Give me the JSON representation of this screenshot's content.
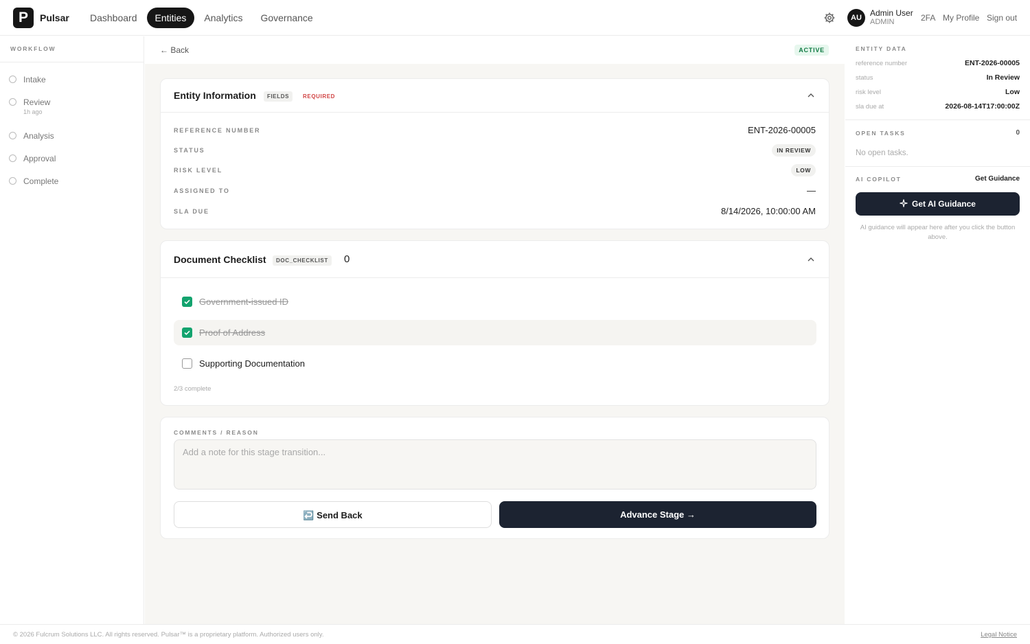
{
  "app": {
    "logo_letter": "P",
    "name": "Pulsar"
  },
  "nav": {
    "items": [
      {
        "label": "Dashboard",
        "active": false
      },
      {
        "label": "Entities",
        "active": true
      },
      {
        "label": "Analytics",
        "active": false
      },
      {
        "label": "Governance",
        "active": false
      }
    ]
  },
  "user": {
    "initials": "AU",
    "name": "Admin User",
    "role": "ADMIN",
    "links": [
      "2FA",
      "My Profile",
      "Sign out"
    ]
  },
  "workflow": {
    "title": "WORKFLOW",
    "steps": [
      {
        "label": "Intake",
        "sub": ""
      },
      {
        "label": "Review",
        "sub": "1h ago"
      },
      {
        "label": "Analysis",
        "sub": ""
      },
      {
        "label": "Approval",
        "sub": ""
      },
      {
        "label": "Complete",
        "sub": ""
      }
    ]
  },
  "main": {
    "back_label": "← Back",
    "status_badge": "ACTIVE",
    "entity_info": {
      "title": "Entity Information",
      "tag_fields": "FIELDS",
      "tag_required": "REQUIRED",
      "fields": [
        {
          "label": "REFERENCE NUMBER",
          "value": "ENT-2026-00005"
        },
        {
          "label": "STATUS",
          "value": "IN REVIEW"
        },
        {
          "label": "RISK LEVEL",
          "value": "LOW"
        },
        {
          "label": "ASSIGNED TO",
          "value": "—"
        },
        {
          "label": "SLA DUE",
          "value": "8/14/2026, 10:00:00 AM"
        }
      ]
    },
    "checklist": {
      "title": "Document Checklist",
      "tag": "DOC_CHECKLIST",
      "count": "0",
      "items": [
        {
          "label": "Government-issued ID",
          "checked": true
        },
        {
          "label": "Proof of Address",
          "checked": true
        },
        {
          "label": "Supporting Documentation",
          "checked": false
        }
      ],
      "progress": "2/3 complete"
    },
    "comments": {
      "label": "COMMENTS / REASON",
      "placeholder": "Add a note for this stage transition...",
      "send_back": "↩️ Send Back",
      "advance": "Advance Stage →"
    }
  },
  "entity_data": {
    "title": "ENTITY DATA",
    "rows": [
      {
        "key": "reference number",
        "value": "ENT-2026-00005"
      },
      {
        "key": "status",
        "value": "In Review"
      },
      {
        "key": "risk level",
        "value": "Low"
      },
      {
        "key": "sla due at",
        "value": "2026-08-14T17:00:00Z"
      }
    ]
  },
  "open_tasks": {
    "title": "OPEN TASKS",
    "count": "0",
    "empty": "No open tasks."
  },
  "ai_copilot": {
    "title": "AI COPILOT",
    "link": "Get Guidance",
    "button": "Get AI Guidance",
    "note": "AI guidance will appear here after you click the button above."
  },
  "footer": {
    "text": "© 2026 Fulcrum Solutions LLC. All rights reserved. Pulsar™ is a proprietary platform. Authorized users only.",
    "legal": "Legal Notice"
  },
  "colors": {
    "accent_dark": "#1c2331",
    "success": "#13a36e",
    "required": "#d14343"
  }
}
